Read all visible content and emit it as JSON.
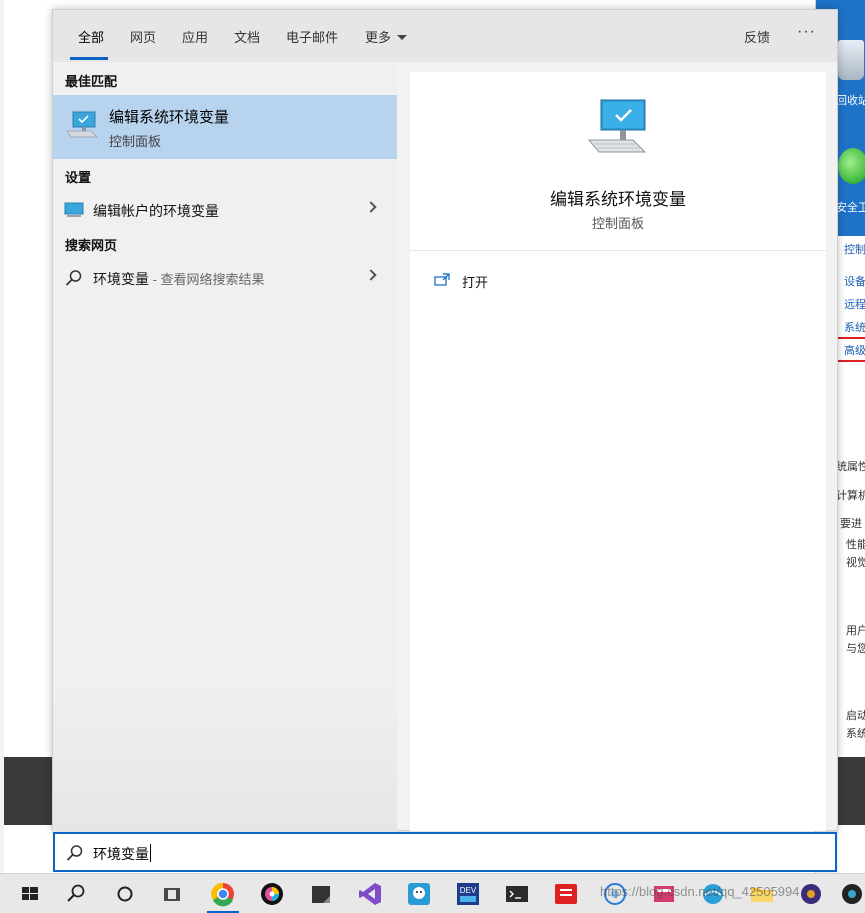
{
  "tabs": [
    {
      "label": "全部",
      "active": true
    },
    {
      "label": "网页"
    },
    {
      "label": "应用"
    },
    {
      "label": "文档"
    },
    {
      "label": "电子邮件"
    },
    {
      "label": "更多"
    }
  ],
  "header_right": {
    "feedback": "反馈",
    "more_options": "···"
  },
  "sections": {
    "best_match": "最佳匹配",
    "settings": "设置",
    "web": "搜索网页"
  },
  "best_match": {
    "title": "编辑系统环境变量",
    "subtitle": "控制面板"
  },
  "settings_item": {
    "label": "编辑帐户的环境变量"
  },
  "web_item": {
    "query": "环境变量",
    "suffix": " - 查看网络搜索结果"
  },
  "preview": {
    "title": "编辑系统环境变量",
    "subtitle": "控制面板",
    "open_label": "打开"
  },
  "search": {
    "value": "环境变量"
  },
  "background": {
    "recycle_label": "回收站",
    "security_label": "安全卫",
    "panel_items": [
      "控制",
      "设备",
      "远程",
      "系统",
      "高级"
    ],
    "props_title": "统属性",
    "tab_computer": "计算机",
    "lines": [
      "要进",
      "性能",
      "视觉",
      "用户",
      "与您",
      "启动",
      "系统"
    ]
  },
  "watermark": "https://blog.csdn.net/qq_42505994",
  "colors": {
    "accent": "#0a64c8",
    "selection": "#b7d3ee"
  },
  "taskbar_icons": [
    "windows-icon",
    "search-icon",
    "cortana-icon",
    "task-view-icon",
    "chrome-icon",
    "color-wheel-icon",
    "sticky-notes-icon",
    "visual-studio-icon",
    "qq-icon",
    "dev-cpp-icon",
    "terminal-icon",
    "youdao-icon",
    "fiddler-icon",
    "browser-icon",
    "net-icon",
    "folder-icon",
    "app-icon"
  ]
}
